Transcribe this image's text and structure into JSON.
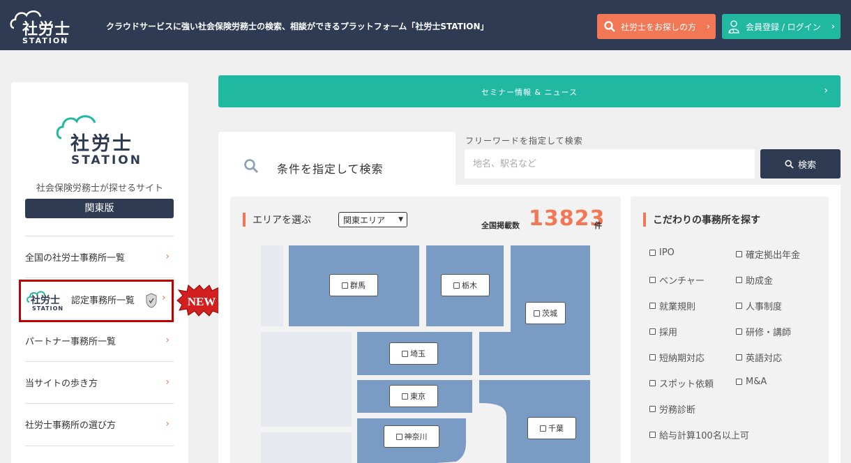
{
  "header": {
    "logo_name": "社労士",
    "logo_sub": "STATION",
    "tagline": "クラウドサービスに強い社会保険労務士の検索、相談ができるプラットフォーム「社労士STATION」",
    "search_button": "社労士をお探しの方",
    "login_button": "会員登録 / ログイン"
  },
  "sidebar": {
    "logo_name": "社労士",
    "logo_sub": "STATION",
    "description": "社会保険労務士が探せるサイト",
    "region": "関東版",
    "items": [
      {
        "label": "全国の社労士事務所一覧"
      },
      {
        "label": "認定事務所一覧"
      },
      {
        "label": "パートナー事務所一覧"
      },
      {
        "label": "当サイトの歩き方"
      },
      {
        "label": "社労士事務所の選び方"
      }
    ],
    "cert_logo_name": "社労士",
    "cert_logo_sub": "STATION",
    "new_badge": "NEW"
  },
  "news_bar": {
    "label": "セミナー情報 & ニュース"
  },
  "search": {
    "tab_title": "条件を指定して検索",
    "freeword_label": "フリーワードを指定して検索",
    "freeword_placeholder": "地名、駅名など",
    "button": "検索"
  },
  "area": {
    "title": "エリアを選ぶ",
    "selected_area": "関東エリア",
    "count_label": "全国掲載数",
    "count": "13823",
    "count_unit": "件",
    "prefectures": [
      "群馬",
      "栃木",
      "茨城",
      "埼玉",
      "東京",
      "千葉",
      "神奈川"
    ]
  },
  "kodawari": {
    "title": "こだわりの事務所を探す",
    "options": [
      "IPO",
      "確定拠出年金",
      "ベンチャー",
      "助成金",
      "就業規則",
      "人事制度",
      "採用",
      "研修・講師",
      "短納期対応",
      "英語対応",
      "スポット依頼",
      "M&A",
      "労務診断",
      "給与計算100名以上可"
    ]
  },
  "colors": {
    "navy": "#2e3b52",
    "teal": "#21b8a2",
    "orange": "#f27754",
    "map_blue": "#7a9bc4",
    "map_light": "#e6e9ef",
    "highlight_red": "#c00000"
  }
}
